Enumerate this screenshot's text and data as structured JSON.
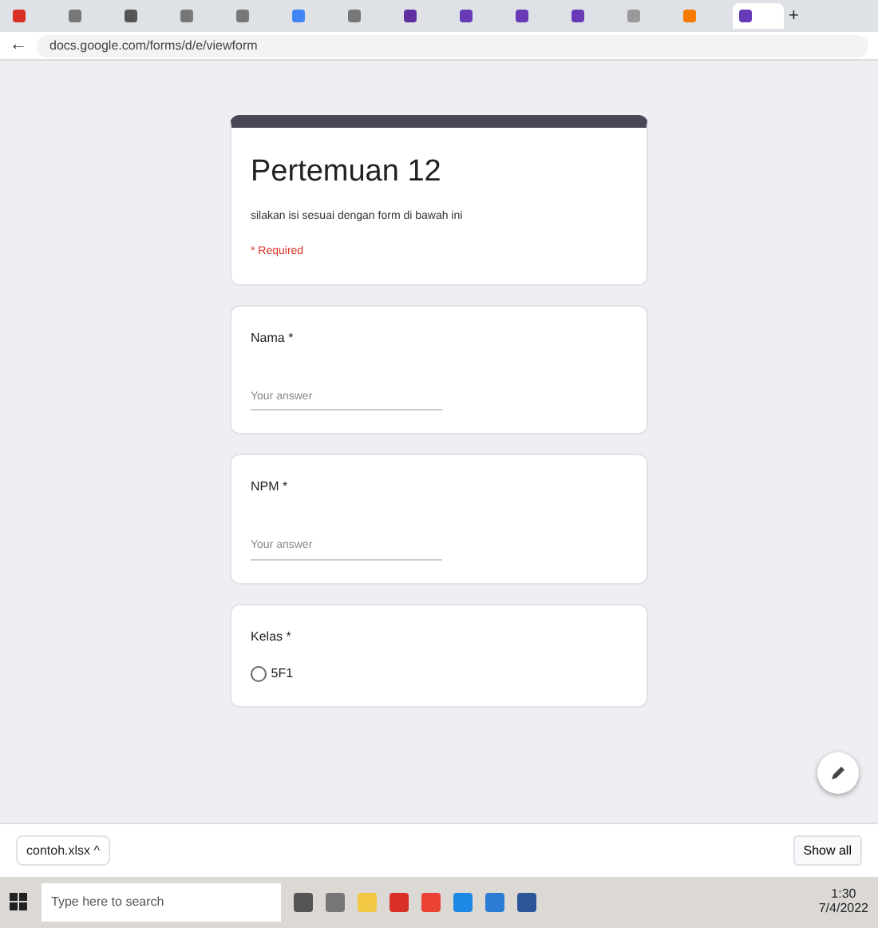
{
  "browser": {
    "tabs": [
      {
        "selected": false,
        "color": "#d93025"
      },
      {
        "selected": false,
        "color": "#777777"
      },
      {
        "selected": false,
        "color": "#555555"
      },
      {
        "selected": false,
        "color": "#777777"
      },
      {
        "selected": false,
        "color": "#777777"
      },
      {
        "selected": false,
        "color": "#4285f4"
      },
      {
        "selected": false,
        "color": "#777777"
      },
      {
        "selected": false,
        "color": "#5f2ea0"
      },
      {
        "selected": false,
        "color": "#673ab7"
      },
      {
        "selected": false,
        "color": "#673ab7"
      },
      {
        "selected": false,
        "color": "#673ab7"
      },
      {
        "selected": false,
        "color": "#999999"
      },
      {
        "selected": false,
        "color": "#f57c00"
      },
      {
        "selected": true,
        "color": "#673ab7"
      }
    ],
    "new_tab": "+",
    "back": "←",
    "address": "docs.google.com/forms/d/e/viewform"
  },
  "form": {
    "title": "Pertemuan 12",
    "description": "silakan isi sesuai dengan form di bawah ini",
    "required_note": "* Required",
    "questions": [
      {
        "kind": "text",
        "label": "Nama *",
        "placeholder": "Your answer"
      },
      {
        "kind": "text",
        "label": "NPM *",
        "placeholder": "Your answer"
      },
      {
        "kind": "radio",
        "label": "Kelas *",
        "options": [
          {
            "label": "5F1",
            "selected": false
          }
        ]
      }
    ]
  },
  "downloads": {
    "file": "contoh.xlsx",
    "caret": "^",
    "show_all": "Show all"
  },
  "taskbar": {
    "search_placeholder": "Type here to search",
    "time": "1:30",
    "date": "7/4/2022"
  }
}
